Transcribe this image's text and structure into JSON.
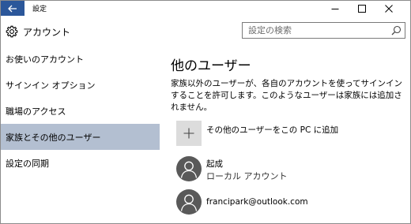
{
  "window": {
    "title": "設定"
  },
  "header": {
    "title": "アカウント",
    "search_placeholder": "設定の検索"
  },
  "sidebar": {
    "items": [
      {
        "label": "お使いのアカウント",
        "selected": false
      },
      {
        "label": "サインイン オプション",
        "selected": false
      },
      {
        "label": "職場のアクセス",
        "selected": false
      },
      {
        "label": "家族とその他のユーザー",
        "selected": true
      },
      {
        "label": "設定の同期",
        "selected": false
      }
    ]
  },
  "main": {
    "title": "他のユーザー",
    "description": "家族以外のユーザーが、各自のアカウントを使ってサインインすることを許可します。このようなユーザーは家族には追加されません。",
    "add_label": "その他のユーザーをこの PC に追加",
    "users": [
      {
        "name": "起成",
        "subtitle": "ローカル アカウント"
      },
      {
        "name": "francipark@outlook.com"
      }
    ]
  },
  "colors": {
    "back_button": "#2b579a",
    "selected_nav": "#b3bfd1",
    "avatar": "#595959",
    "plus_tile": "#dcdcdc"
  },
  "icons": [
    "back-arrow-icon",
    "minimize-icon",
    "maximize-icon",
    "close-icon",
    "gear-icon",
    "search-icon",
    "plus-icon",
    "user-avatar-icon"
  ]
}
